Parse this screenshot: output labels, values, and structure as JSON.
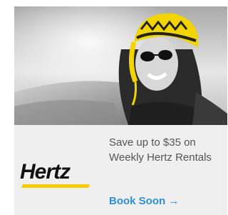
{
  "ad": {
    "brand": "Hertz",
    "headline_line1": "Save up to $35 on",
    "headline_line2": "Weekly Hertz Rentals",
    "cta_label": "Book Soon →",
    "colors": {
      "brand_yellow": "#f5cc00",
      "cta_blue": "#2f8fcf",
      "text_gray": "#555555",
      "panel_bg": "#efefef"
    }
  }
}
